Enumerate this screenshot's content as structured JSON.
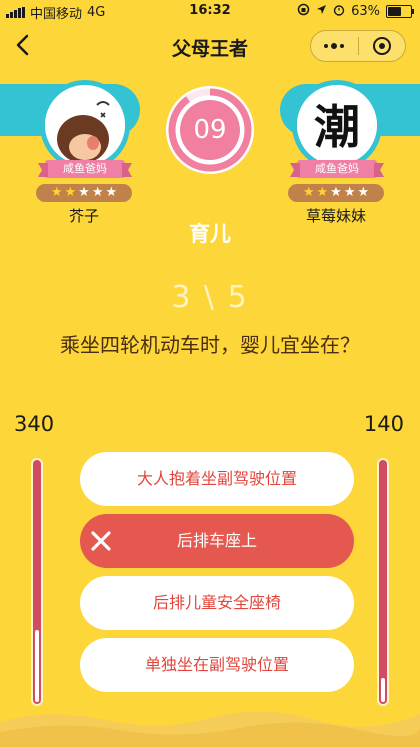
{
  "status_bar": {
    "carrier": "中国移动",
    "network": "4G",
    "time": "16:32",
    "battery": "63%",
    "battery_level": 0.63
  },
  "nav": {
    "title": "父母王者"
  },
  "player_left": {
    "name": "芥子",
    "title": "咸鱼爸妈",
    "stars_on": 2,
    "stars_total": 5,
    "score": "340",
    "meter_level": 0.3
  },
  "player_right": {
    "name": "草莓妹妹",
    "title": "咸鱼爸妈",
    "avatar_char": "潮",
    "stars_on": 2,
    "stars_total": 5,
    "score": "140",
    "meter_level": 0.1
  },
  "timer": {
    "value": "09",
    "remaining_fraction": 0.9
  },
  "category": "育儿",
  "progress": "3 \\ 5",
  "question": "乘坐四轮机动车时，婴儿宜坐在？",
  "options": [
    {
      "label": "大人抱着坐副驾驶位置",
      "state": "normal"
    },
    {
      "label": "后排车座上",
      "state": "wrong"
    },
    {
      "label": "后排儿童安全座椅",
      "state": "normal"
    },
    {
      "label": "单独坐在副驾驶位置",
      "state": "normal"
    }
  ],
  "colors": {
    "background": "#fdd63a",
    "band": "#33c3d3",
    "pink": "#f07fa0",
    "wrong": "#e5584f",
    "option_text": "#e0463d"
  }
}
